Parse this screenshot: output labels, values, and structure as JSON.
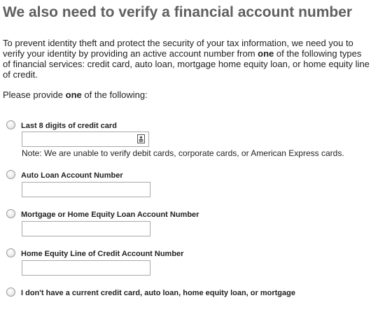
{
  "page": {
    "title": "We also need to verify a financial account number",
    "intro_part1": "To prevent identity theft and protect the security of your tax information, we need you to verify your identity by providing an active account number from ",
    "intro_emphasis": "one",
    "intro_part2": " of the following types of financial services: credit card, auto loan, mortgage home equity loan, or home equity line of credit.",
    "prompt_part1": "Please provide ",
    "prompt_emphasis": "one",
    "prompt_part2": " of the following:"
  },
  "options": [
    {
      "label": "Last 8 digits of credit card",
      "value": "",
      "placeholder": "",
      "icon": "contact-card-icon",
      "note": "Note: We are unable to verify debit cards, corporate cards, or American Express cards."
    },
    {
      "label": "Auto Loan Account Number",
      "value": "",
      "placeholder": ""
    },
    {
      "label": "Mortgage or Home Equity Loan Account Number",
      "value": "",
      "placeholder": ""
    },
    {
      "label": "Home Equity Line of Credit Account Number",
      "value": "",
      "placeholder": ""
    },
    {
      "label": "I don't have a current credit card, auto loan, home equity loan, or mortgage"
    }
  ],
  "colors": {
    "title": "#5f5f5f",
    "text": "#222222",
    "input_border": "#a9a9a9"
  }
}
